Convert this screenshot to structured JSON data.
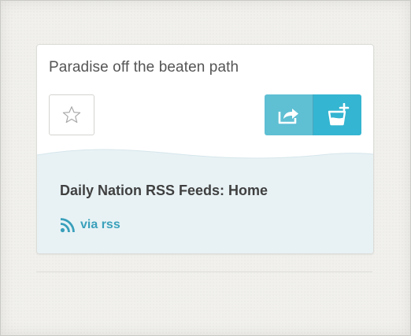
{
  "card": {
    "title": "Paradise off the beaten path",
    "source_name": "Daily Nation RSS Feeds: Home",
    "via_label": "via rss"
  },
  "icons": {
    "favorite": "star-outline-icon",
    "share": "share-arrow-icon",
    "save": "add-to-bucket-icon",
    "feed": "rss-icon"
  },
  "colors": {
    "accent_share": "#5fbfd3",
    "accent_save": "#34b5d1",
    "link": "#3aa0bb",
    "source_bg": "#e8f2f5"
  }
}
